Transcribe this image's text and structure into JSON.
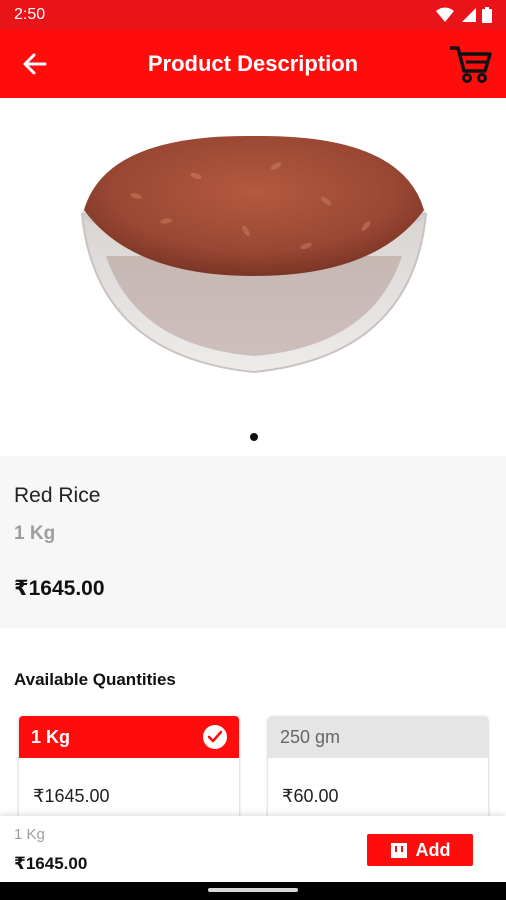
{
  "status_bar": {
    "time": "2:50"
  },
  "app_bar": {
    "title": "Product Description"
  },
  "product": {
    "name": "Red Rice",
    "quantity": "1 Kg",
    "price": "₹1645.00"
  },
  "carousel": {
    "image_count": 1,
    "active_index": 0
  },
  "quantities": {
    "heading": "Available Quantities",
    "options": [
      {
        "label": "1 Kg",
        "price": "₹1645.00",
        "selected": true
      },
      {
        "label": "250 gm",
        "price": "₹60.00",
        "selected": false
      }
    ]
  },
  "bottom_bar": {
    "quantity": "1 Kg",
    "price": "₹1645.00",
    "add_label": "Add"
  },
  "colors": {
    "primary_red": "#ff0d0d",
    "status_red": "#e8141a",
    "info_bg": "#f7f7f7"
  }
}
